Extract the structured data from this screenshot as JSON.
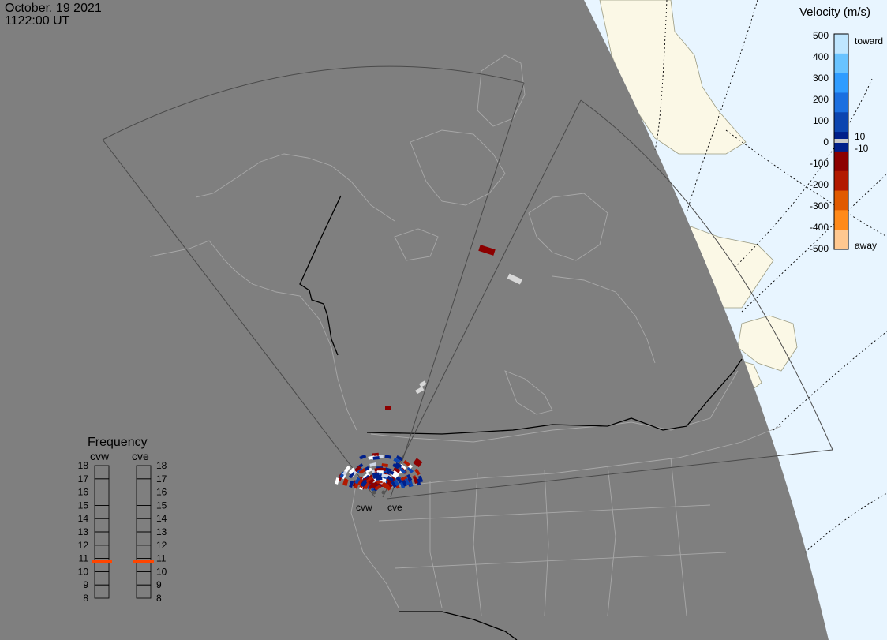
{
  "header": {
    "date": "October, 19 2021",
    "time": "1122:00 UT"
  },
  "colors": {
    "night_shade": "#7f7f7f",
    "ocean_day": "#e8f5ff",
    "land_day": "#fbf8e6",
    "fov_outline": "#4a4a4a",
    "coast_line": "#a8a8a8",
    "border_line": "#000000",
    "freq_marker": "#ff4500"
  },
  "velocity_scale": {
    "title": "Velocity (m/s)",
    "label_toward": "toward",
    "label_away": "away",
    "ticks": [
      "500",
      "400",
      "300",
      "200",
      "100",
      "0",
      "-100",
      "-200",
      "-300",
      "-400",
      "-500"
    ],
    "inner_ticks": [
      "10",
      "-10"
    ],
    "colors": [
      "#bfe6ff",
      "#69c3ff",
      "#2f9cff",
      "#1a6fe0",
      "#0b45b0",
      "#001f8a",
      "#8c0000",
      "#b21a00",
      "#e05a00",
      "#ff8a1a",
      "#ffc890"
    ]
  },
  "frequency": {
    "title": "Frequency",
    "radars": [
      {
        "name": "cvw",
        "value_mhz": 10.8
      },
      {
        "name": "cve",
        "value_mhz": 10.8
      }
    ],
    "ticks": [
      "18",
      "17",
      "16",
      "15",
      "14",
      "13",
      "12",
      "11",
      "10",
      "9",
      "8"
    ]
  },
  "radar_sites": [
    {
      "code": "cvw"
    },
    {
      "code": "cve"
    }
  ]
}
